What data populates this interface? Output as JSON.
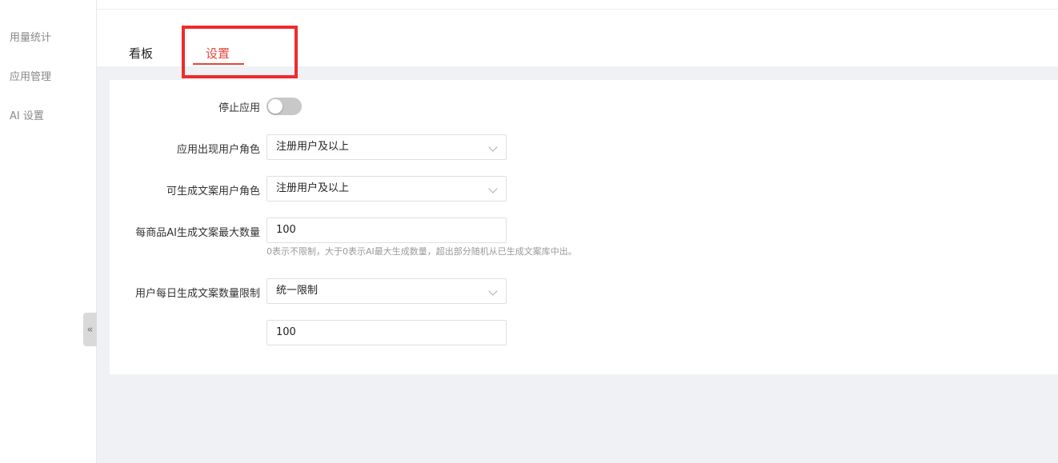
{
  "sidebar": {
    "items": [
      {
        "label": "用量统计"
      },
      {
        "label": "应用管理"
      },
      {
        "label": "AI 设置"
      }
    ],
    "collapse_glyph": "«"
  },
  "tabs": [
    {
      "label": "看板",
      "active": false
    },
    {
      "label": "设置",
      "active": true
    }
  ],
  "form": {
    "stop_app": {
      "label": "停止应用",
      "enabled": false
    },
    "app_visible_role": {
      "label": "应用出现用户角色",
      "value": "注册用户及以上"
    },
    "copy_gen_role": {
      "label": "可生成文案用户角色",
      "value": "注册用户及以上"
    },
    "max_per_product": {
      "label": "每商品AI生成文案最大数量",
      "value": "100",
      "hint": "0表示不限制，大于0表示AI最大生成数量，超出部分随机从已生成文案库中出。"
    },
    "daily_limit": {
      "label": "用户每日生成文案数量限制",
      "value": "统一限制"
    },
    "daily_limit_count": {
      "value": "100"
    }
  },
  "colors": {
    "accent": "#e4473c",
    "highlight": "#ee2b2b",
    "content_bg": "#f0f1f5"
  },
  "icons": {
    "collapse": "chevron-double-left-icon",
    "select_arrow": "chevron-down-icon"
  }
}
